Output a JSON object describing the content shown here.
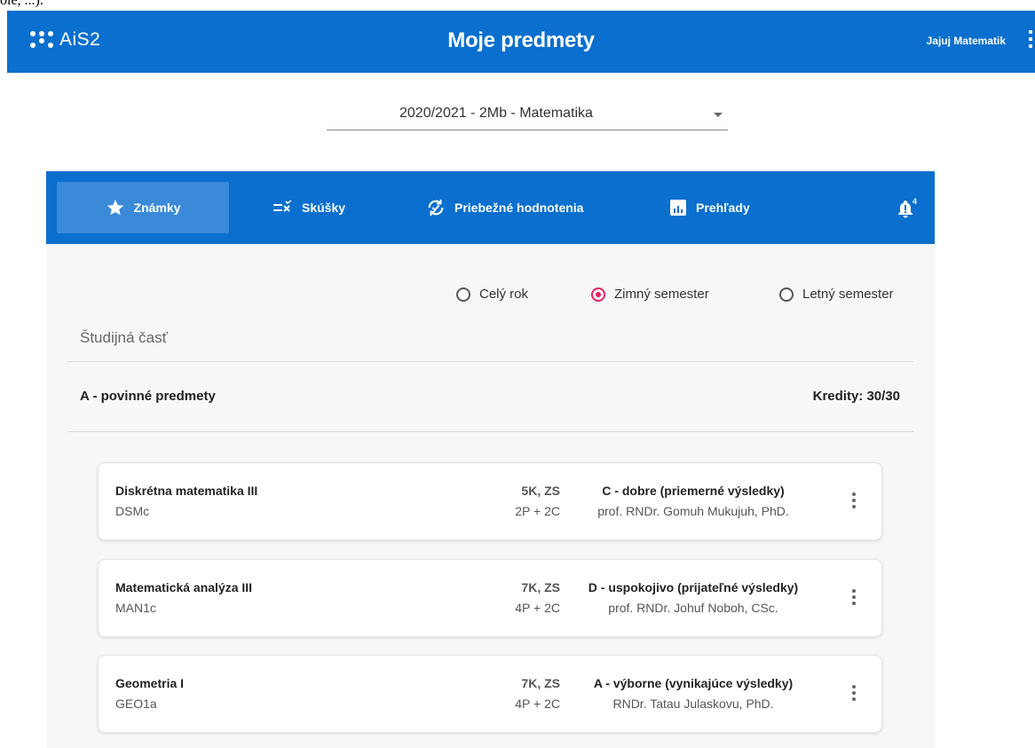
{
  "cropped_text": "ole, ...).",
  "header": {
    "logo_text": "AiS2",
    "title": "Moje predmety",
    "user": "Jajuj Matematik"
  },
  "period": {
    "selected": "2020/2021 - 2Mb - Matematika"
  },
  "tabs": [
    {
      "label": "Známky",
      "icon": "star-icon",
      "active": true
    },
    {
      "label": "Skúšky",
      "icon": "exam-list-icon",
      "active": false
    },
    {
      "label": "Priebežné hodnotenia",
      "icon": "progress-check-icon",
      "active": false
    },
    {
      "label": "Prehľady",
      "icon": "bar-chart-icon",
      "active": false
    }
  ],
  "notifications": {
    "count": "4",
    "icon": "bell-alert-icon"
  },
  "semester_filter": {
    "options": [
      "Celý rok",
      "Zimný semester",
      "Letný semester"
    ],
    "selected": "Zimný semester"
  },
  "section": {
    "title": "Študijná časť",
    "group_title": "A - povinné predmety",
    "credits": "Kredity: 30/30"
  },
  "subjects": [
    {
      "name": "Diskrétna matematika III",
      "code": "DSMc",
      "credits": "5K, ZS",
      "hours": "2P + 2C",
      "grade": "C - dobre (priemerné výsledky)",
      "teacher": "prof. RNDr. Gomuh Mukujuh, PhD."
    },
    {
      "name": "Matematická analýza III",
      "code": "MAN1c",
      "credits": "7K, ZS",
      "hours": "4P + 2C",
      "grade": "D - uspokojivo (prijateľné výsledky)",
      "teacher": "prof. RNDr. Johuf Noboh, CSc."
    },
    {
      "name": "Geometria I",
      "code": "GEO1a",
      "credits": "7K, ZS",
      "hours": "4P + 2C",
      "grade": "A - výborne (vynikajúce výsledky)",
      "teacher": "RNDr. Tatau Julaskovu, PhD."
    }
  ],
  "colors": {
    "primary": "#0a6fce",
    "active_tab": "#3a8ad9",
    "radio_accent": "#e91e63"
  }
}
